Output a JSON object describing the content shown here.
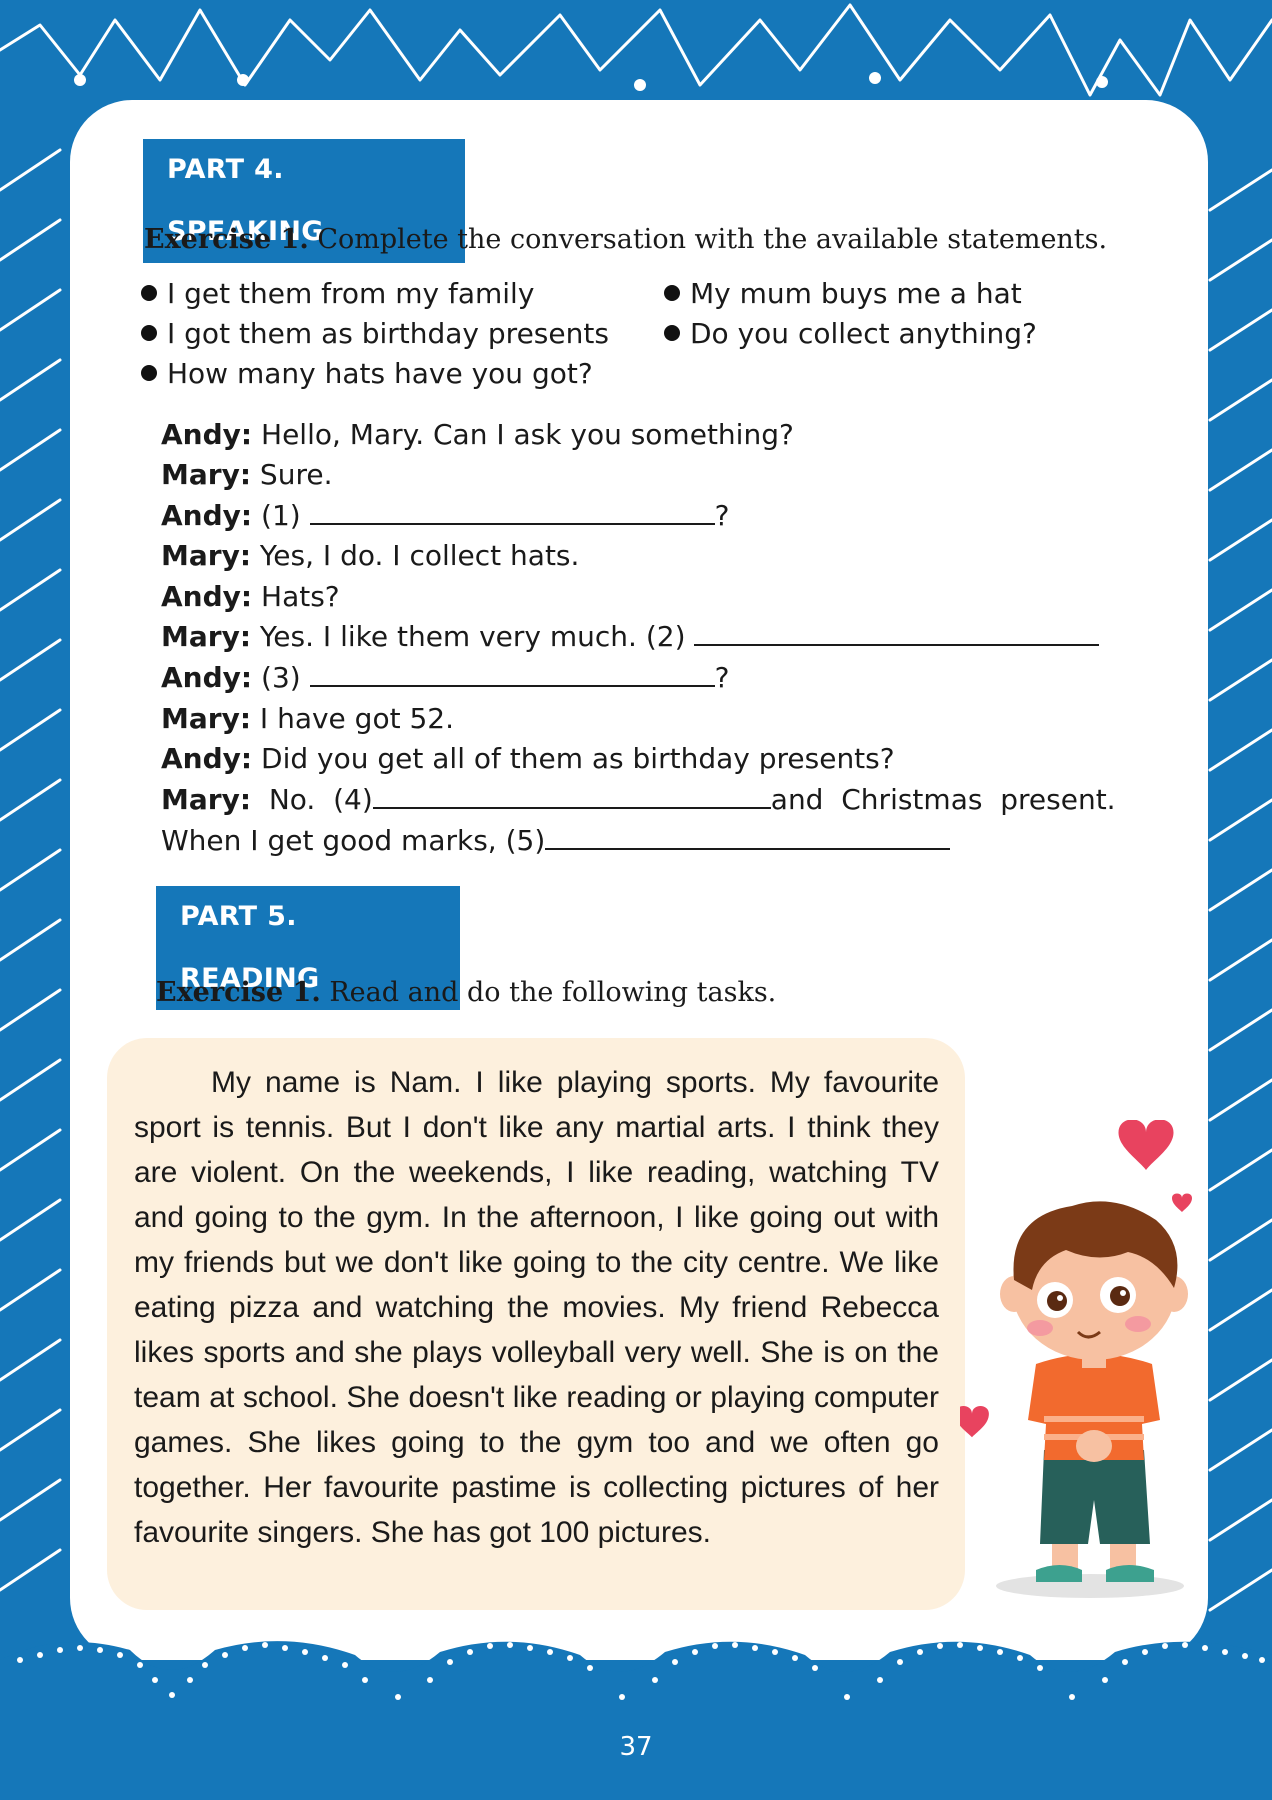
{
  "page": {
    "number": "37",
    "colors": {
      "frame_blue": "#1577b9",
      "card_white": "#ffffff",
      "reading_box": "#fdf0dd"
    }
  },
  "speaking": {
    "header": "PART 4. SPEAKING",
    "exercise": {
      "label": "Exercise 1.",
      "instruction": "Complete the conversation with the available statements."
    },
    "options_left": [
      "I get them from my family",
      "I got them as birthday presents",
      "How many hats have you got?"
    ],
    "options_right": [
      "My mum buys me a hat",
      "Do you collect anything?"
    ],
    "dialogue": [
      {
        "speaker": "Andy:",
        "before": "Hello, Mary. Can I ask you something?",
        "after": ""
      },
      {
        "speaker": "Mary:",
        "before": "Sure.",
        "after": ""
      },
      {
        "speaker": "Andy:",
        "before": "(1)",
        "after": "?"
      },
      {
        "speaker": "Mary:",
        "before": "Yes, I do. I collect hats.",
        "after": ""
      },
      {
        "speaker": "Andy:",
        "before": "Hats?",
        "after": ""
      },
      {
        "speaker": "Mary:",
        "before": "Yes. I like them very much. (2)",
        "after": ""
      },
      {
        "speaker": "Andy:",
        "before": "(3)",
        "after": "?"
      },
      {
        "speaker": "Mary:",
        "before": "I have got 52.",
        "after": ""
      },
      {
        "speaker": "Andy:",
        "before": "Did you get all of them as birthday presents?",
        "after": ""
      },
      {
        "speaker": "Mary:",
        "before": "No.  (4)",
        "after": "and  Christmas  present."
      }
    ],
    "dialogue_last_line": {
      "before": "When I get good marks, (5)",
      "after": ""
    }
  },
  "reading": {
    "header": "PART 5. READING",
    "exercise": {
      "label": "Exercise 1.",
      "instruction": "Read and do the following tasks."
    },
    "passage": "My name is Nam. I like playing sports. My favourite sport is tennis. But I don't like any martial arts. I think they are violent. On the weekends, I like reading, watching TV and going to the gym. In the afternoon, I like going out with my friends but we don't like going to the city centre. We like eating pizza and watching the movies. My friend Rebecca likes sports and she plays volleyball very well. She is on the team at school. She doesn't like reading or playing computer games. She likes going to the gym too and we often go together. Her favourite pastime is collecting pictures of her favourite singers. She has got 100 pictures."
  },
  "illustration": {
    "icon": "boy-with-hearts-illustration"
  }
}
